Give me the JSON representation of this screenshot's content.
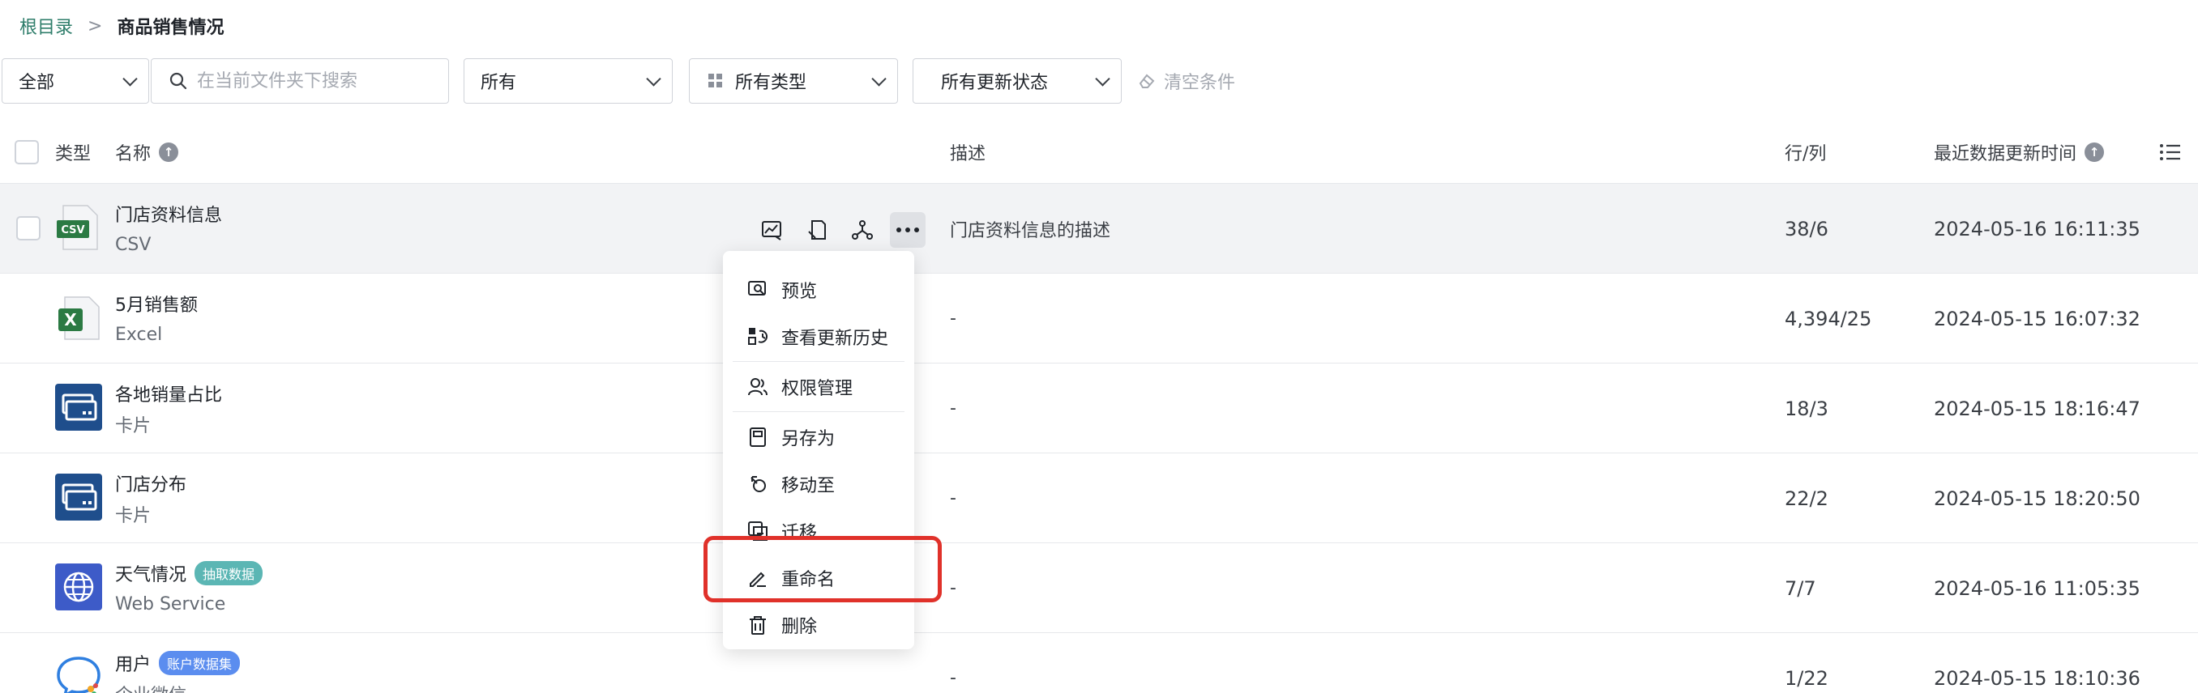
{
  "breadcrumb": {
    "root": "根目录",
    "separator": ">",
    "current": "商品销售情况"
  },
  "filters": {
    "scope": "全部",
    "search_placeholder": "在当前文件夹下搜索",
    "owner": "所有",
    "type": "所有类型",
    "update_status": "所有更新状态",
    "clear": "清空条件"
  },
  "columns": {
    "type": "类型",
    "name": "名称",
    "description": "描述",
    "rows_cols": "行/列",
    "updated": "最近数据更新时间"
  },
  "rows": [
    {
      "name": "门店资料信息",
      "sub": "CSV",
      "desc": "门店资料信息的描述",
      "rc": "38/6",
      "time": "2024-05-16 16:11:35",
      "icon": "csv-icon",
      "icon_text": "CSV"
    },
    {
      "name": "5月销售额",
      "sub": "Excel",
      "desc": "-",
      "rc": "4,394/25",
      "time": "2024-05-15 16:07:32",
      "icon": "excel-icon",
      "icon_text": "X"
    },
    {
      "name": "各地销量占比",
      "sub": "卡片",
      "desc": "-",
      "rc": "18/3",
      "time": "2024-05-15 18:16:47",
      "icon": "card-icon"
    },
    {
      "name": "门店分布",
      "sub": "卡片",
      "desc": "-",
      "rc": "22/2",
      "time": "2024-05-15 18:20:50",
      "icon": "card-icon"
    },
    {
      "name": "天气情况",
      "badge": "抽取数据",
      "sub": "Web Service",
      "desc": "-",
      "rc": "7/7",
      "time": "2024-05-16 11:05:35",
      "icon": "globe-icon"
    },
    {
      "name": "用户",
      "badge": "账户数据集",
      "sub": "企业微信",
      "desc": "-",
      "rc": "1/22",
      "time": "2024-05-15 18:10:36",
      "icon": "wechat-work-icon"
    }
  ],
  "menu": {
    "preview": "预览",
    "history": "查看更新历史",
    "permissions": "权限管理",
    "save_as": "另存为",
    "move_to": "移动至",
    "migrate": "迁移",
    "rename": "重命名",
    "delete": "删除"
  },
  "colors": {
    "accent_green": "#2e7d6a",
    "highlight_red": "#e0312a",
    "badge_teal": "#5bb6b4",
    "badge_blue": "#5b8def",
    "card_blue": "#1f4e8c",
    "globe_blue": "#3d5bc8"
  }
}
